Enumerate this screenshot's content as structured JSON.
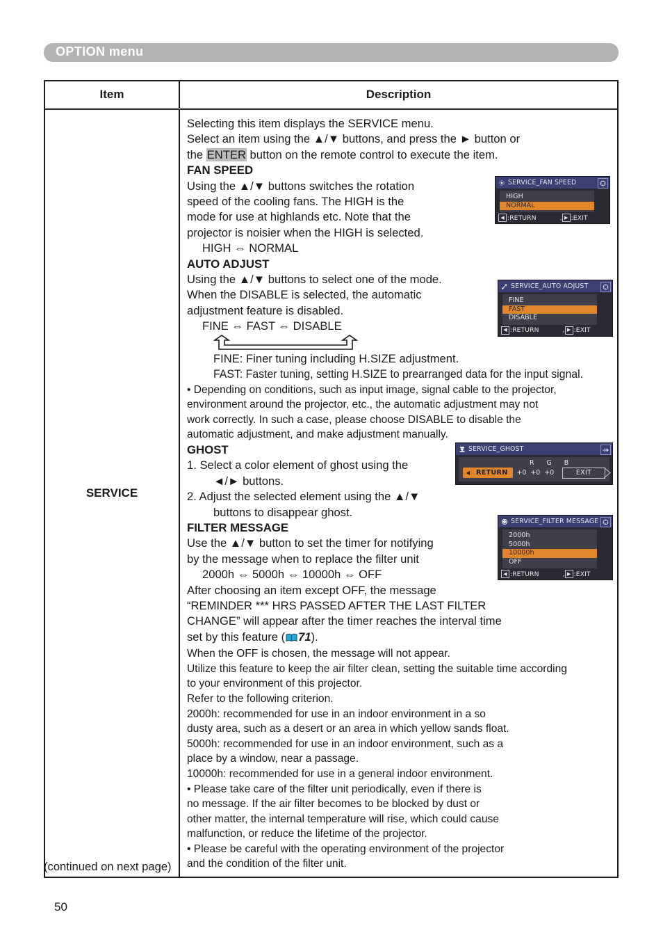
{
  "header": {
    "title": "OPTION menu"
  },
  "table": {
    "columns": {
      "item": "Item",
      "description": "Description"
    },
    "item_label": "SERVICE"
  },
  "content": {
    "intro_line1": "Selecting this item displays the SERVICE menu.",
    "intro_line2a": "Select an item using the ▲/▼ buttons, and press the ► button or",
    "intro_line3a": "the ",
    "intro_key": "ENTER",
    "intro_line3b": " button on the remote control to execute the item.",
    "fan_speed_heading": "FAN SPEED",
    "fan_speed_body": "Using the ▲/▼ buttons switches the rotation\nspeed of the cooling fans. The HIGH is the\nmode for use at highlands etc. Note that the\nprojector is noisier when the HIGH is selected.",
    "fan_speed_cycle": "HIGH ⇔ NORMAL",
    "auto_adjust_heading": "AUTO ADJUST",
    "auto_adjust_body": "Using the ▲/▼ buttons to select one of the mode.\nWhen the DISABLE is selected, the automatic\nadjustment feature is disabled.",
    "auto_adjust_cycle": "FINE ⇔ FAST ⇔ DISABLE",
    "auto_adjust_fine": "FINE: Finer tuning including H.SIZE adjustment.",
    "auto_adjust_fast": "FAST: Faster tuning, setting H.SIZE to prearranged data for the input signal.",
    "auto_adjust_note": "• Depending on conditions, such as input image, signal cable to the projector,\nenvironment around the projector, etc., the automatic adjustment may not\nwork correctly.  In such a case, please choose DISABLE to disable the\nautomatic adjustment, and make adjustment manually.",
    "ghost_heading": "GHOST",
    "ghost_step1": "1. Select a color element of ghost using the",
    "ghost_step1b": "◄/► buttons.",
    "ghost_step2": "2. Adjust the selected element using the ▲/▼",
    "ghost_step2b": "buttons to disappear ghost.",
    "filter_heading": "FILTER MESSAGE",
    "filter_body": "Use the ▲/▼ button to set the timer for notifying\nby the message when to replace the filter unit",
    "filter_cycle": "2000h ⇔ 5000h ⇔ 10000h ⇔ OFF",
    "filter_body2": "After choosing an item except OFF, the message\n“REMINDER *** HRS PASSED AFTER THE LAST FILTER\nCHANGE” will appear after the timer reaches the interval time",
    "filter_ref_pre": "set by this feature (",
    "filter_ref_num": "71",
    "filter_ref_post": ").",
    "filter_body3": "When the OFF is chosen, the message will not appear.",
    "filter_body4": "Utilize this feature to keep the air filter clean, setting the suitable time according\nto your environment of this projector.\nRefer to the following criterion.",
    "filter_crit1": "2000h: recommended for use in an indoor environment in a so\ndusty area, such as a desert or an area in which yellow sands float.",
    "filter_crit2": "5000h: recommended for use in an indoor environment, such as a\nplace by a window, near a passage.",
    "filter_crit3": "10000h: recommended for use in a general indoor environment.",
    "filter_note1": "• Please take care of the filter unit periodically, even if there is\nno message. If the air filter becomes to be blocked by dust or\nother matter, the internal temperature will rise, which could cause\nmalfunction, or reduce the lifetime of the projector.",
    "filter_note2": "• Please be careful with the operating environment of the projector\nand the condition of the filter unit."
  },
  "osd_fan_speed": {
    "title": "SERVICE_FAN SPEED",
    "items": [
      "HIGH",
      "NORMAL"
    ],
    "selected": "NORMAL",
    "return_label": ":RETURN",
    "exit_label": ":EXIT",
    "separator": ","
  },
  "osd_auto_adjust": {
    "title": "SERVICE_AUTO ADJUST",
    "items": [
      "FINE",
      "FAST",
      "DISABLE"
    ],
    "selected": "FAST",
    "return_label": ":RETURN",
    "exit_label": ":EXIT",
    "separator": ","
  },
  "osd_ghost": {
    "title": "SERVICE_GHOST",
    "channels": [
      "R",
      "G",
      "B"
    ],
    "values": [
      "+0",
      "+0",
      "+0"
    ],
    "return_label": "RETURN",
    "exit_label": "EXIT"
  },
  "osd_filter_message": {
    "title": "SERVICE_FILTER MESSAGE",
    "items": [
      "2000h",
      "5000h",
      "10000h",
      "OFF"
    ],
    "selected": "10000h",
    "return_label": ":RETURN",
    "exit_label": ":EXIT",
    "separator": ","
  },
  "footer": {
    "continued": "(continued on next page)",
    "page_number": "50"
  },
  "colors": {
    "banner": "#b3b3b3",
    "osd_title_bar": "#3b3f72",
    "osd_body": "#2a2a33",
    "osd_list": "#3f3f49",
    "osd_highlight": "#e2862c",
    "book_icon": "#2aa8d8"
  }
}
